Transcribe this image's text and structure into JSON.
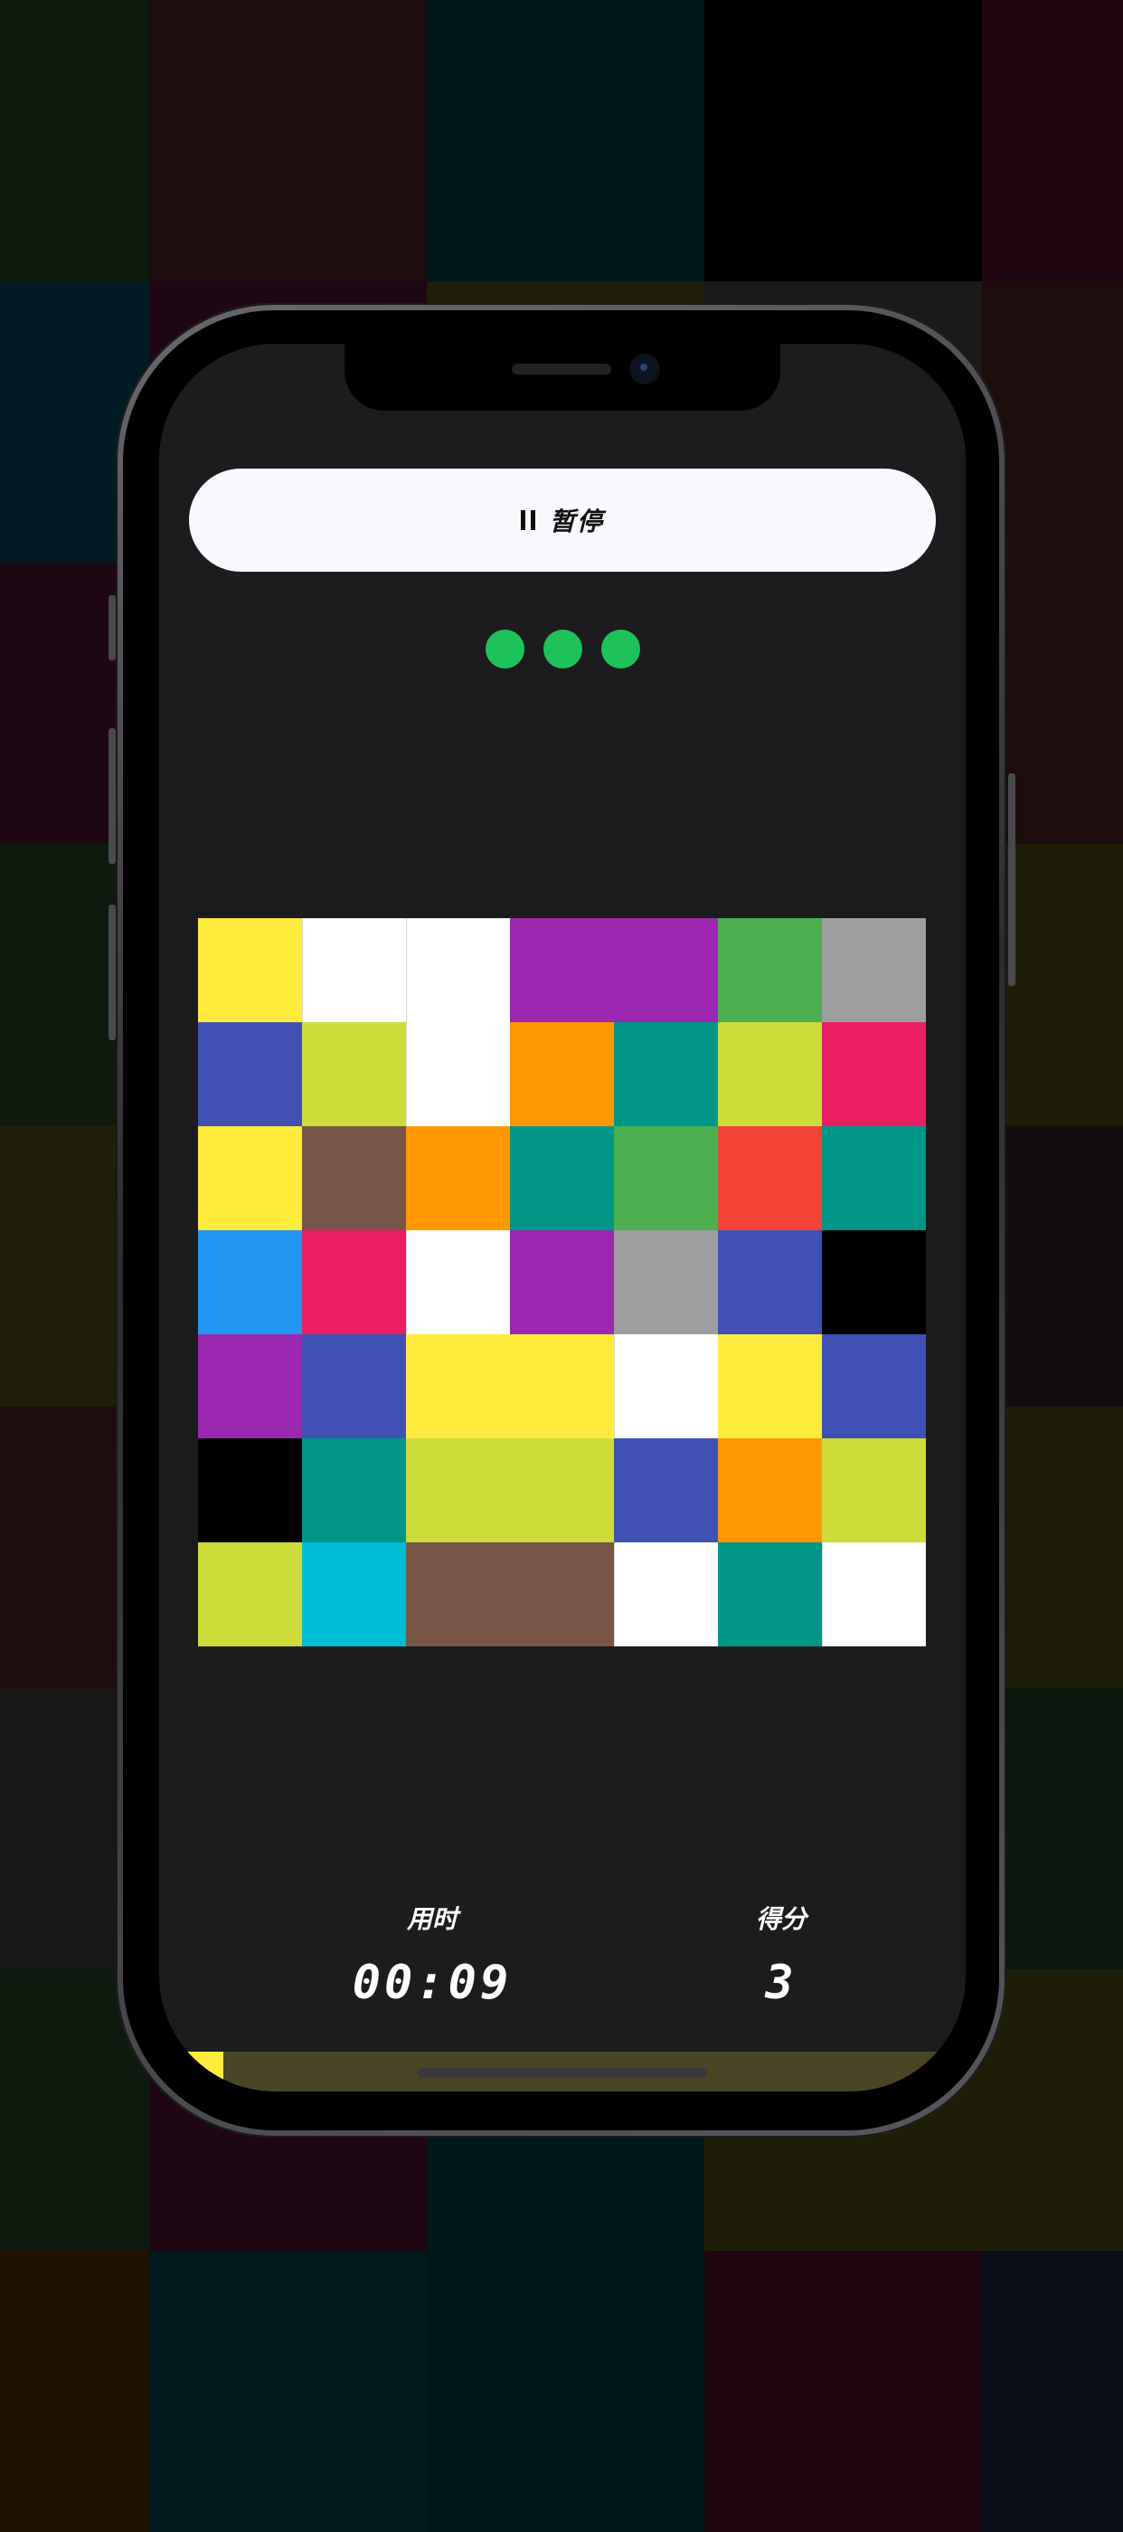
{
  "pause_button": {
    "label": "暂停",
    "icon": "pause-icon"
  },
  "lives": {
    "count": 3,
    "color": "#1dc35a"
  },
  "board": {
    "rows": 7,
    "cols": 7,
    "cells": [
      [
        "#ffeb3b",
        "#ffffff",
        "#ffffff",
        "#9c27b0",
        "#9c27b0",
        "#4caf50",
        "#9e9e9e"
      ],
      [
        "#3f51b5",
        "#cddc39",
        "#ffffff",
        "#ff9800",
        "#009688",
        "#cddc39",
        "#e91e63"
      ],
      [
        "#ffeb3b",
        "#795548",
        "#ff9800",
        "#009688",
        "#4caf50",
        "#f44336",
        "#009688"
      ],
      [
        "#2196f3",
        "#e91e63",
        "#ffffff",
        "#9c27b0",
        "#9e9e9e",
        "#3f51b5",
        "#000000"
      ],
      [
        "#9c27b0",
        "#3f51b5",
        "#ffeb3b",
        "#ffeb3b",
        "#ffffff",
        "#ffeb3b",
        "#3f51b5"
      ],
      [
        "#000000",
        "#009688",
        "#cddc39",
        "#cddc39",
        "#3f51b5",
        "#ff9800",
        "#cddc39"
      ],
      [
        "#cddc39",
        "#00bcd4",
        "#795548",
        "#795548",
        "#ffffff",
        "#009688",
        "#ffffff"
      ]
    ]
  },
  "stats": {
    "time_label": "用时",
    "time_value": "00:09",
    "score_label": "得分",
    "score_value": "3"
  },
  "timer_bar": {
    "progress": 0.08,
    "fill_color": "#ffeb3b",
    "track_color": "#4a4524"
  },
  "background_tiles": {
    "colors": [
      [
        "#0f1a0f",
        "#1f0c0c",
        "#00181a",
        "#000000",
        "#1f0610"
      ],
      [
        "#001a26",
        "#1f0613",
        "#1f1e08",
        "#1a1a1a",
        "#1f0c0c"
      ],
      [
        "#1f0613",
        "#1f0613",
        "#1f1e08",
        "#1a1a1a",
        "#1f0c0c"
      ],
      [
        "#0f1a0f",
        "#1f0613",
        "#1f1e08",
        "#1a1a1a",
        "#1e1e08"
      ],
      [
        "#1f1e08",
        "#1f1e08",
        "#1f1e08",
        "#1a1a1a",
        "#140d0f"
      ],
      [
        "#1f0c0c",
        "#1f0c0c",
        "#1f1e08",
        "#1a1a1a",
        "#1e1e08"
      ],
      [
        "#171717",
        "#171717",
        "#171717",
        "#171717",
        "#0a170c"
      ],
      [
        "#0f1a0f",
        "#1f0613",
        "#00181a",
        "#1e1e08",
        "#1e1e08"
      ],
      [
        "#1f1300",
        "#001a1e",
        "#00181a",
        "#1f0610",
        "#0b0d19"
      ]
    ]
  }
}
